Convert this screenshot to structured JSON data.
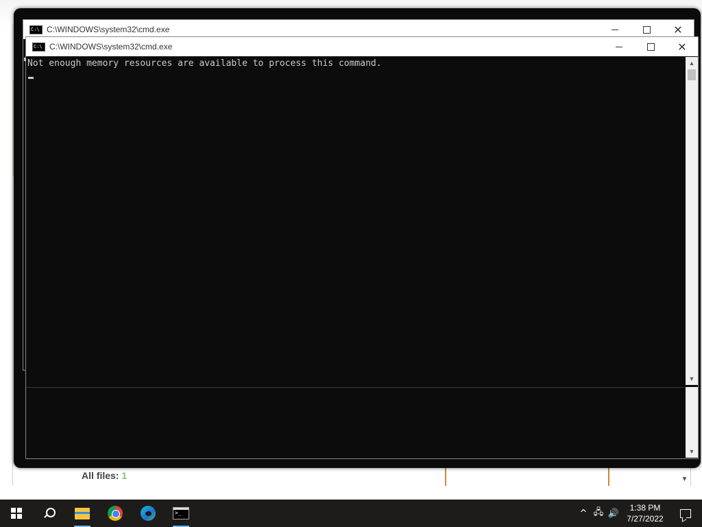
{
  "background_app": {
    "files_label": "All files:",
    "files_count": "1"
  },
  "cmd_back": {
    "title": "C:\\WINDOWS\\system32\\cmd.exe"
  },
  "cmd_front": {
    "title": "C:\\WINDOWS\\system32\\cmd.exe",
    "console_line": "Not enough memory resources are available to process this command."
  },
  "taskbar": {
    "apps": [
      "start",
      "search",
      "file-explorer",
      "chrome",
      "edge",
      "command-prompt"
    ],
    "clock_time": "1:38 PM",
    "clock_date": "7/27/2022"
  },
  "colors": {
    "console_bg": "#0c0c0c",
    "console_text": "#cccccc",
    "taskbar_bg": "#1e1b1b",
    "active_underline": "#76b9ed"
  }
}
